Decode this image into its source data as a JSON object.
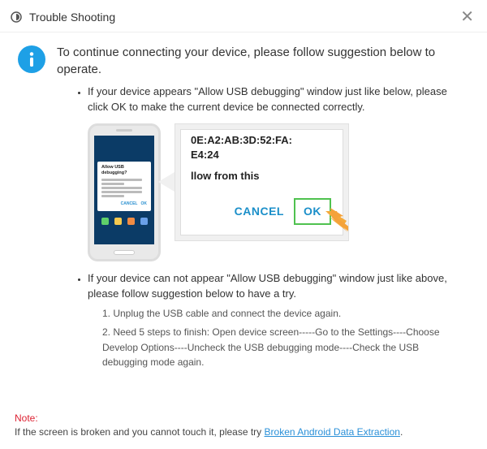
{
  "titlebar": {
    "title": "Trouble Shooting"
  },
  "intro": "To continue connecting your device, please follow suggestion below to operate.",
  "item1": "If your device appears \"Allow USB debugging\" window just like below, please click OK to make the current device  be connected correctly.",
  "phone_dialog": {
    "title": "Allow USB debugging?",
    "cancel": "CANCEL",
    "ok": "OK"
  },
  "zoom": {
    "fingerprint_line1": "0E:A2:AB:3D:52:FA:",
    "fingerprint_line2": "E4:24",
    "allow_from": "llow from this",
    "cancel": "CANCEL",
    "ok": "OK"
  },
  "item2": "If your device can not appear \"Allow USB debugging\" window just like above, please follow suggestion below to have a try.",
  "substeps": {
    "s1": "1. Unplug the USB cable and connect the device again.",
    "s2": "2. Need 5 steps to finish: Open device screen-----Go to the Settings----Choose Develop Options----Uncheck the USB debugging mode----Check the USB debugging mode again."
  },
  "footer": {
    "note_label": "Note:",
    "text_before": "If the screen is broken and you cannot touch it, please try ",
    "link": "Broken Android Data Extraction",
    "text_after": "."
  }
}
